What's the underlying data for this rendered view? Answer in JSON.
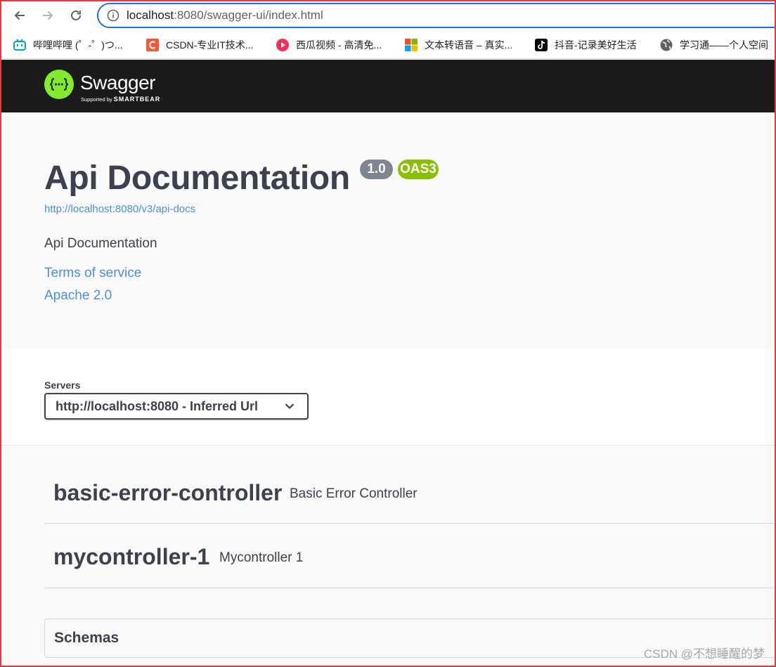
{
  "browser": {
    "url_host": "localhost",
    "url_rest": ":8080/swagger-ui/index.html",
    "bookmarks": [
      {
        "label": "哔哩哔哩 (゜-゜)つ...",
        "icon": "bilibili-icon",
        "color": "#00a1d6"
      },
      {
        "label": "CSDN-专业IT技术...",
        "icon": "csdn-icon",
        "color": "#fc5531"
      },
      {
        "label": "西瓜视频 - 高清免...",
        "icon": "xigua-icon",
        "color": "#fe2c55"
      },
      {
        "label": "文本转语音 – 真实...",
        "icon": "microsoft-icon",
        "color": "#f25022"
      },
      {
        "label": "抖音-记录美好生活",
        "icon": "douyin-icon",
        "color": "#000000"
      },
      {
        "label": "学习通——个人空间",
        "icon": "globe-icon",
        "color": "#5f6368"
      }
    ]
  },
  "swagger": {
    "brand": "Swagger",
    "supported_by": "Supported by",
    "smartbear": "SMARTBEAR",
    "accent": "#85ea2d",
    "topbar_color": "#1b1b1b"
  },
  "info": {
    "title": "Api Documentation",
    "version": "1.0",
    "oas": "OAS3",
    "docs_url": "http://localhost:8080/v3/api-docs",
    "description": "Api Documentation",
    "terms": "Terms of service",
    "license": "Apache 2.0",
    "link_color": "#4990e2"
  },
  "servers": {
    "label": "Servers",
    "selected": "http://localhost:8080 - Inferred Url"
  },
  "tags": [
    {
      "name": "basic-error-controller",
      "description": "Basic Error Controller"
    },
    {
      "name": "mycontroller-1",
      "description": "Mycontroller 1"
    }
  ],
  "schemas": {
    "title": "Schemas"
  },
  "watermark": "CSDN @不想睡醒的梦"
}
